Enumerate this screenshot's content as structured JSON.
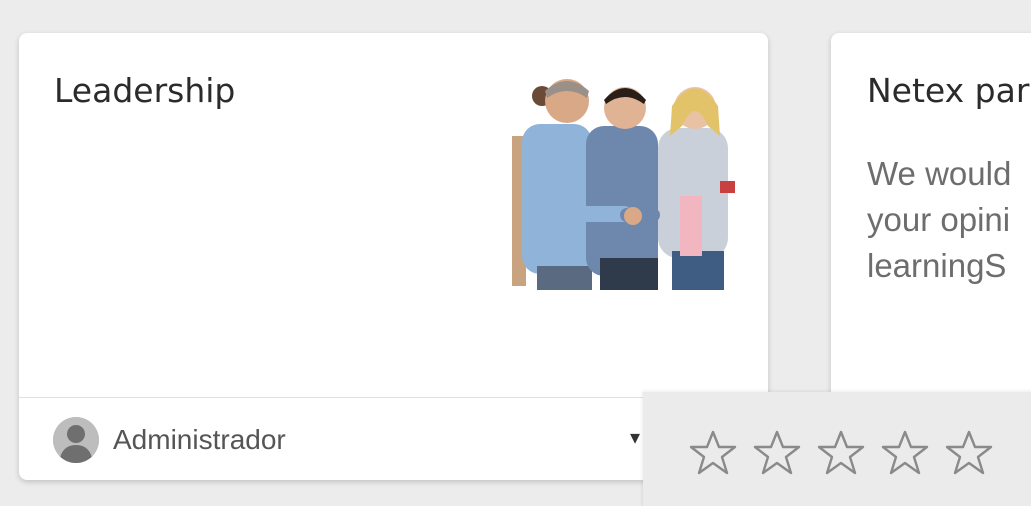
{
  "cards": [
    {
      "title": "Leadership",
      "image_alt": "people-shaking-hands-image",
      "author": "Administrador"
    },
    {
      "title": "Netex par",
      "description_lines": [
        "We would",
        "your opini",
        "learningS"
      ]
    }
  ],
  "rating": {
    "stars_total": 5,
    "stars_filled": 0,
    "star_icon": "star-outline-icon"
  },
  "colors": {
    "page_bg": "#ececec",
    "card_bg": "#ffffff",
    "rating_bg": "#ebebeb",
    "star_stroke": "#8a8a8a"
  }
}
